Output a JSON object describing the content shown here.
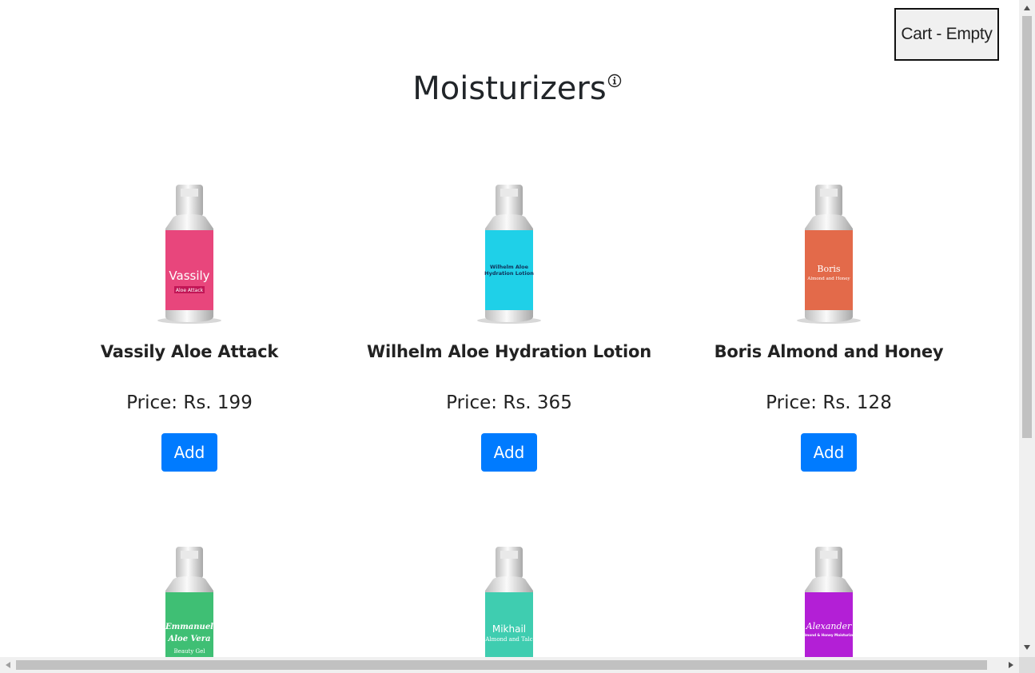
{
  "header": {
    "cart_label": "Cart - Empty",
    "title": "Moisturizers"
  },
  "products": [
    {
      "name": "Vassily Aloe Attack",
      "price": "Price: Rs. 199",
      "add_label": "Add",
      "label_color": "#e8467c",
      "brand": "Vassily",
      "sub": "Aloe Attack"
    },
    {
      "name": "Wilhelm Aloe Hydration Lotion",
      "price": "Price: Rs. 365",
      "add_label": "Add",
      "label_color": "#1fd0e8",
      "brand": "Wilhelm Aloe",
      "sub": "Hydration Lotion"
    },
    {
      "name": "Boris Almond and Honey",
      "price": "Price: Rs. 128",
      "add_label": "Add",
      "label_color": "#e36a4a",
      "brand": "Boris",
      "sub": "Almond and Honey"
    },
    {
      "name": "",
      "price": "",
      "add_label": "",
      "label_color": "#3fbf74",
      "brand": "Emmanuel",
      "sub": "Aloe Vera"
    },
    {
      "name": "",
      "price": "",
      "add_label": "",
      "label_color": "#3fcdb0",
      "brand": "Mikhail",
      "sub": "Almond and Talc"
    },
    {
      "name": "",
      "price": "",
      "add_label": "",
      "label_color": "#b31fd6",
      "brand": "Alexander",
      "sub": "Almond & Honey Moisturizer"
    }
  ],
  "bottle_extra_text": "Beauty Gel",
  "colors": {
    "accent": "#007bff",
    "scrollbar_thumb": "#c1c1c1"
  }
}
